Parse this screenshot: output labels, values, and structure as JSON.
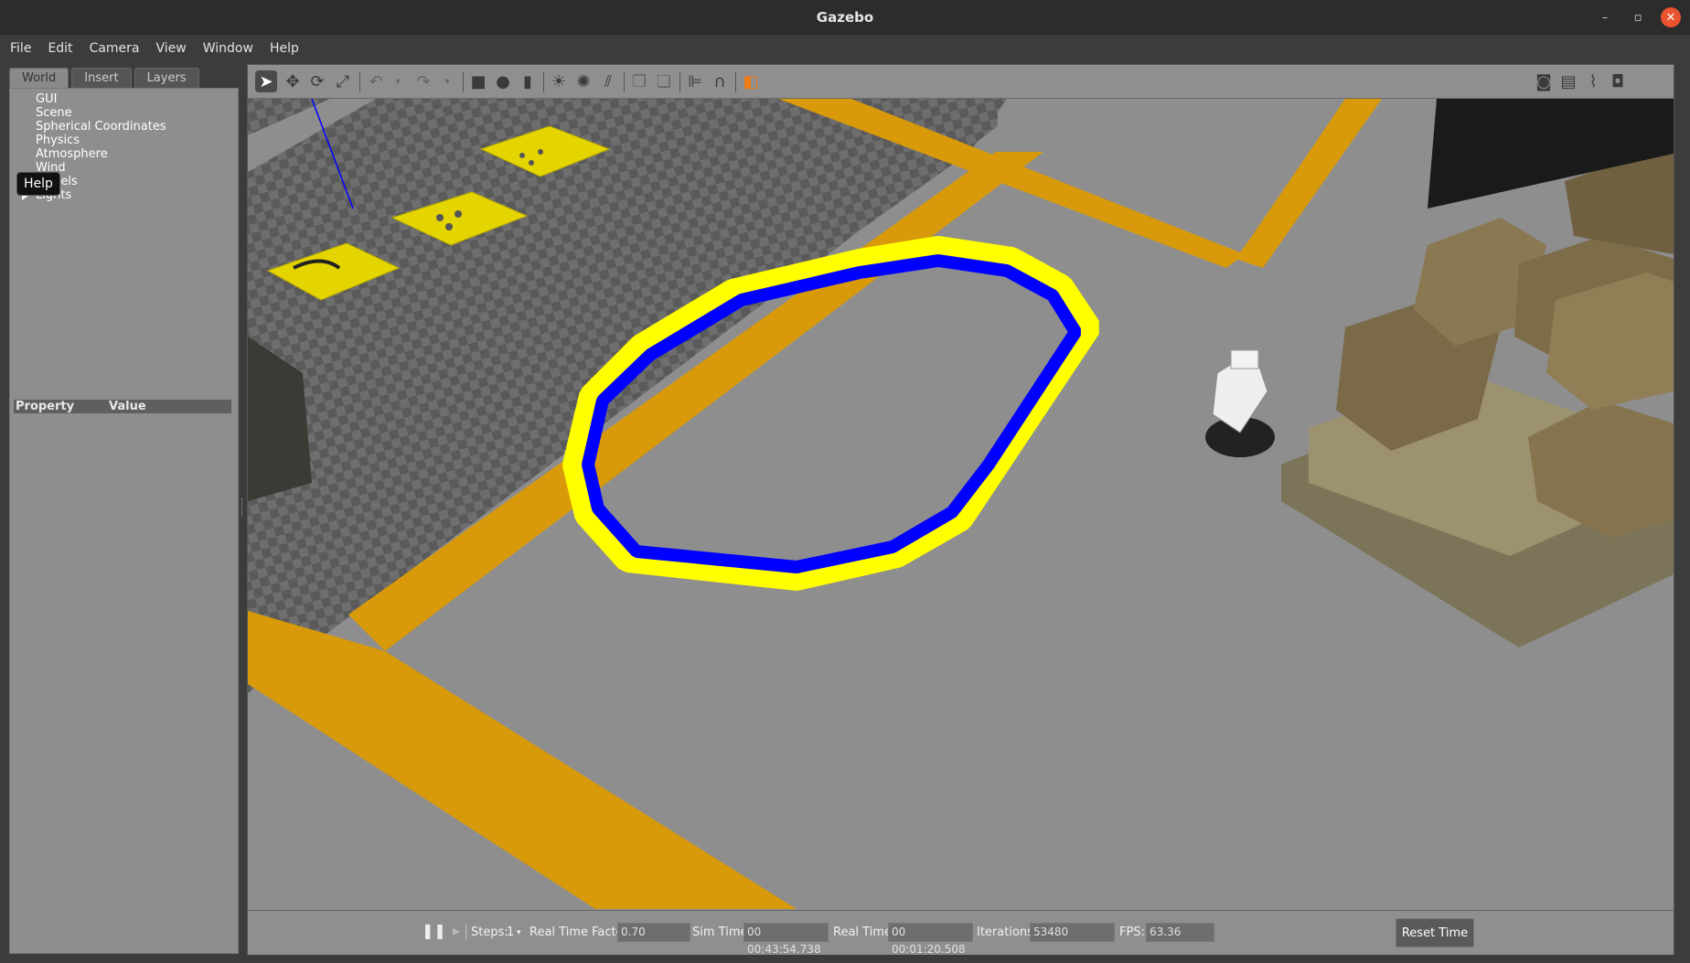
{
  "window": {
    "title": "Gazebo"
  },
  "menu": [
    "File",
    "Edit",
    "Camera",
    "View",
    "Window",
    "Help"
  ],
  "left_panel": {
    "tabs": [
      "World",
      "Insert",
      "Layers"
    ],
    "tree": [
      "GUI",
      "Scene",
      "Spherical Coordinates",
      "Physics",
      "Atmosphere",
      "Wind",
      "Models",
      "Lights"
    ],
    "tooltip": "Help",
    "property_header": {
      "property": "Property",
      "value": "Value"
    }
  },
  "toolbar": {
    "icons": [
      "select-arrow",
      "translate",
      "rotate",
      "scale",
      "undo",
      "undo-history",
      "redo",
      "redo-history",
      "box",
      "sphere",
      "cylinder",
      "point-light",
      "spot-light",
      "directional-light",
      "copy",
      "paste",
      "align",
      "snap",
      "view-angle",
      "screenshot",
      "log",
      "plot",
      "record-video"
    ]
  },
  "bottom": {
    "steps_label": "Steps:",
    "steps_value": "1",
    "rtf_label": "Real Time Factor:",
    "rtf_value": "0.70",
    "sim_label": "Sim Time:",
    "sim_value": "00 00:43:54.738",
    "real_label": "Real Time:",
    "real_value": "00 00:01:20.508",
    "iter_label": "Iterations:",
    "iter_value": "53480",
    "fps_label": "FPS:",
    "fps_value": "63.36",
    "reset_label": "Reset Time"
  },
  "colors": {
    "floor": "#8c8c8c",
    "safety_stripe": "#d89a0a",
    "track_outer": "#ffff00",
    "track_inner": "#0000ff",
    "boxes": "#7a6a45"
  }
}
